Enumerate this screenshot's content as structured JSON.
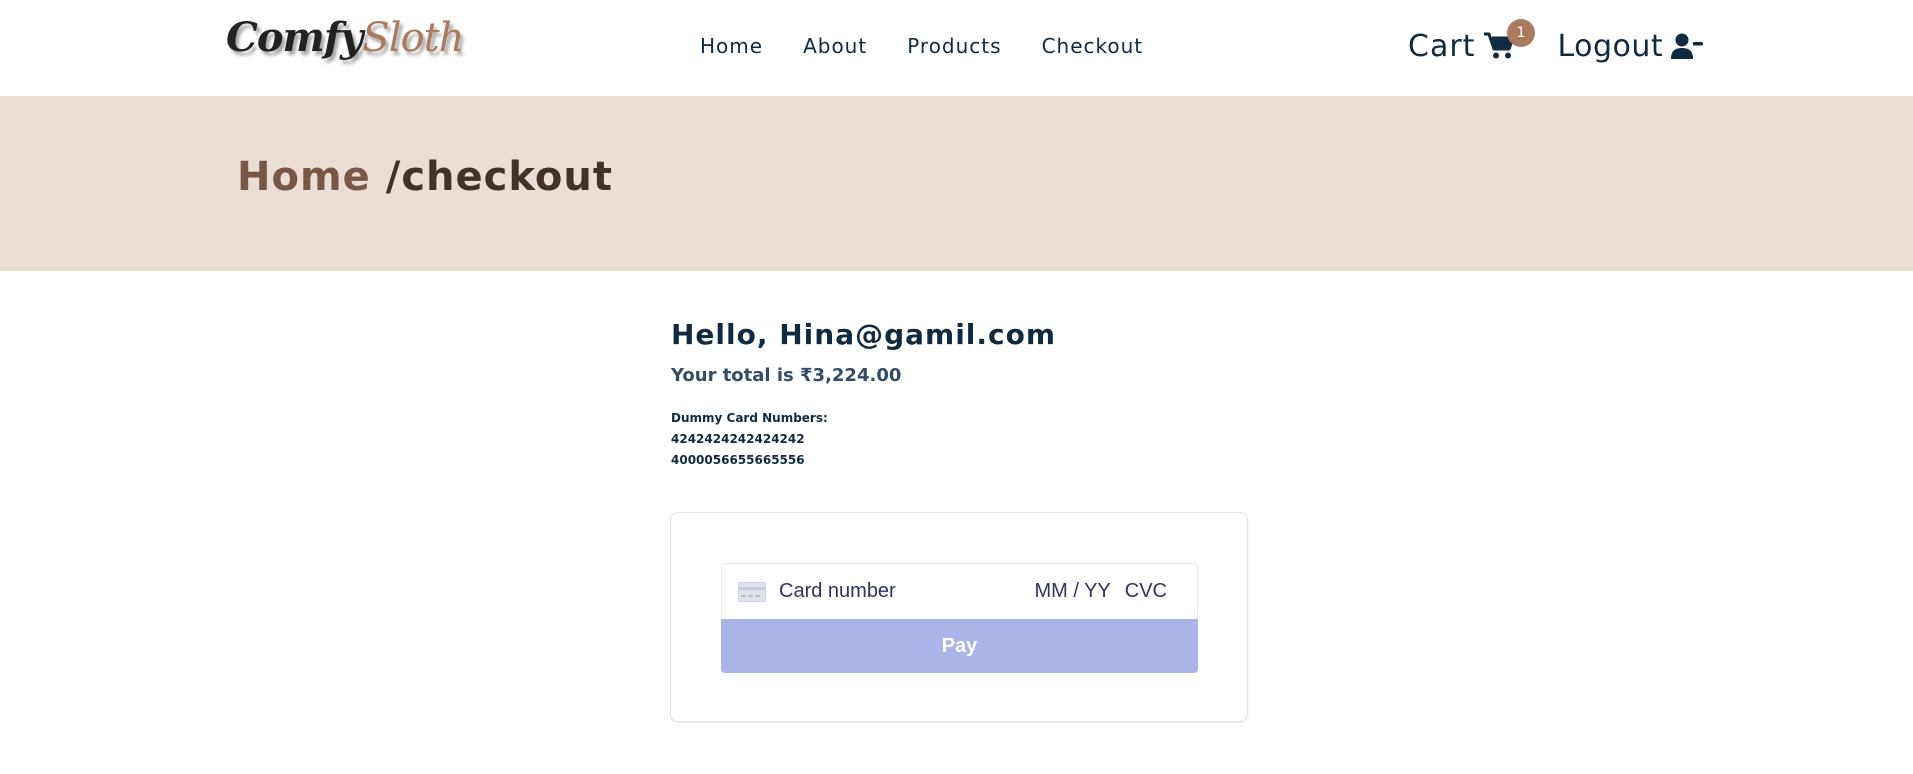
{
  "logo": {
    "part1": "Comfy",
    "part2": "Sloth"
  },
  "nav": {
    "links": [
      "Home",
      "About",
      "Products",
      "Checkout"
    ]
  },
  "cart": {
    "label": "Cart",
    "count": "1",
    "icon": "cart-icon"
  },
  "logout": {
    "label": "Logout",
    "icon": "user-minus-icon"
  },
  "hero": {
    "home": "Home",
    "current": "/checkout"
  },
  "checkout": {
    "greeting": "Hello, Hina@gamil.com",
    "total": "Your total is ₹3,224.00",
    "dummy_title": "Dummy Card Numbers:",
    "dummy_numbers": [
      "4242424242424242",
      "4000056655665556"
    ]
  },
  "payment": {
    "card_placeholder": "Card number",
    "expiry_placeholder": "MM / YY",
    "cvc_placeholder": "CVC",
    "pay_label": "Pay"
  },
  "colors": {
    "brand": "#ab7a5f",
    "hero_bg": "#eaded7",
    "text_dark": "#102a42",
    "pay_button": "#a9b4e8"
  }
}
